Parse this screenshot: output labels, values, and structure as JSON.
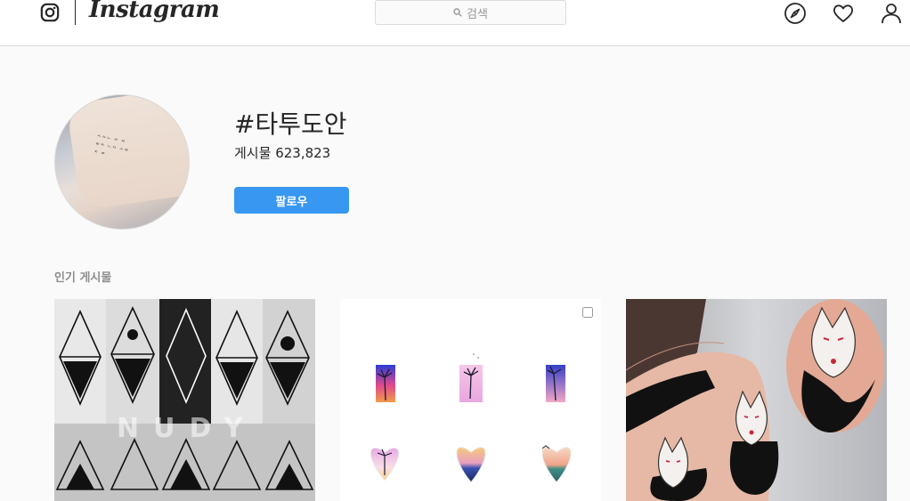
{
  "header": {
    "brand": "Instagram",
    "search_placeholder": "검색",
    "icons": [
      "instagram-glyph-icon",
      "explore-compass-icon",
      "heart-icon",
      "profile-icon"
    ]
  },
  "hashtag": {
    "title": "#타투도안",
    "posts_label": "게시물",
    "posts_count": "623,823",
    "follow_label": "팔로우"
  },
  "sections": {
    "top_posts_label": "인기 게시물"
  },
  "posts": [
    {
      "watermark": "NUDY",
      "multi": false
    },
    {
      "watermark": "",
      "multi": true
    },
    {
      "watermark": "",
      "multi": false
    }
  ],
  "colors": {
    "accent": "#3897f0",
    "border": "#dbdbdb",
    "background": "#fafafa",
    "text": "#262626",
    "muted": "#8e8e8e"
  }
}
